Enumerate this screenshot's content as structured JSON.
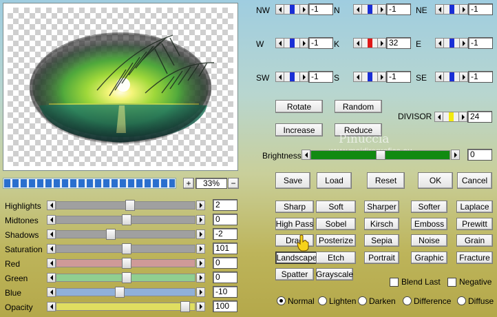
{
  "preview": {
    "zoom": "33%",
    "zoom_plus": "+",
    "zoom_minus": "−",
    "progress_segments": 21
  },
  "neighbors": [
    {
      "label": "NW",
      "value": "-1",
      "thumb_color": "#1a2fd6"
    },
    {
      "label": "N",
      "value": "-1",
      "thumb_color": "#1a2fd6"
    },
    {
      "label": "NE",
      "value": "-1",
      "thumb_color": "#1a2fd6"
    },
    {
      "label": "W",
      "value": "-1",
      "thumb_color": "#1a2fd6"
    },
    {
      "label": "K",
      "value": "32",
      "thumb_color": "#e01818"
    },
    {
      "label": "E",
      "value": "-1",
      "thumb_color": "#1a2fd6"
    },
    {
      "label": "SW",
      "value": "-1",
      "thumb_color": "#1a2fd6"
    },
    {
      "label": "S",
      "value": "-1",
      "thumb_color": "#1a2fd6"
    },
    {
      "label": "SE",
      "value": "-1",
      "thumb_color": "#1a2fd6"
    }
  ],
  "controls": {
    "rotate": "Rotate",
    "random": "Random",
    "increase": "Increase",
    "reduce": "Reduce",
    "divisor_label": "DIVISOR",
    "divisor_value": "24",
    "divisor_thumb_color": "#f2ea10",
    "brightness_label": "Brightness",
    "brightness_value": "0",
    "brightness_fill_color": "#118a11"
  },
  "actions": {
    "save": "Save",
    "load": "Load",
    "reset": "Reset",
    "ok": "OK",
    "cancel": "Cancel"
  },
  "watermark": {
    "line1": "Pinuccia",
    "line2": "www.maidiregrafica.eu"
  },
  "adjustments": [
    {
      "label": "Highlights",
      "value": "2",
      "level": 0.53,
      "track_color": "#a0a0a0"
    },
    {
      "label": "Midtones",
      "value": "0",
      "level": 0.5,
      "track_color": "#a0a0a0"
    },
    {
      "label": "Shadows",
      "value": "-2",
      "level": 0.38,
      "track_color": "#a0a0a0"
    },
    {
      "label": "Saturation",
      "value": "101",
      "level": 0.5,
      "track_color": "#a0a0a0"
    },
    {
      "label": "Red",
      "value": "0",
      "level": 0.5,
      "track_color": "#cf9a98"
    },
    {
      "label": "Green",
      "value": "0",
      "level": 0.5,
      "track_color": "#90cf90"
    },
    {
      "label": "Blue",
      "value": "-10",
      "level": 0.45,
      "track_color": "#90b0d8"
    },
    {
      "label": "Opacity",
      "value": "100",
      "level": 0.95,
      "track_color": "#e0de60"
    }
  ],
  "presets": [
    [
      "Sharp",
      "Soft",
      "Sharper",
      "Softer",
      "Laplace"
    ],
    [
      "High Pass",
      "Sobel",
      "Kirsch",
      "Emboss",
      "Prewitt"
    ],
    [
      "Drag",
      "Posterize",
      "Sepia",
      "Noise",
      "Grain"
    ],
    [
      "Landscape",
      "Etch",
      "Portrait",
      "Graphic",
      "Fracture"
    ],
    [
      "Spatter",
      "Grayscale"
    ]
  ],
  "selected_preset": "Landscape",
  "checkboxes": {
    "blend_last": "Blend Last",
    "negative": "Negative"
  },
  "blend_modes": [
    "Normal",
    "Lighten",
    "Darken",
    "Difference",
    "Diffuse"
  ],
  "selected_blend": "Normal"
}
